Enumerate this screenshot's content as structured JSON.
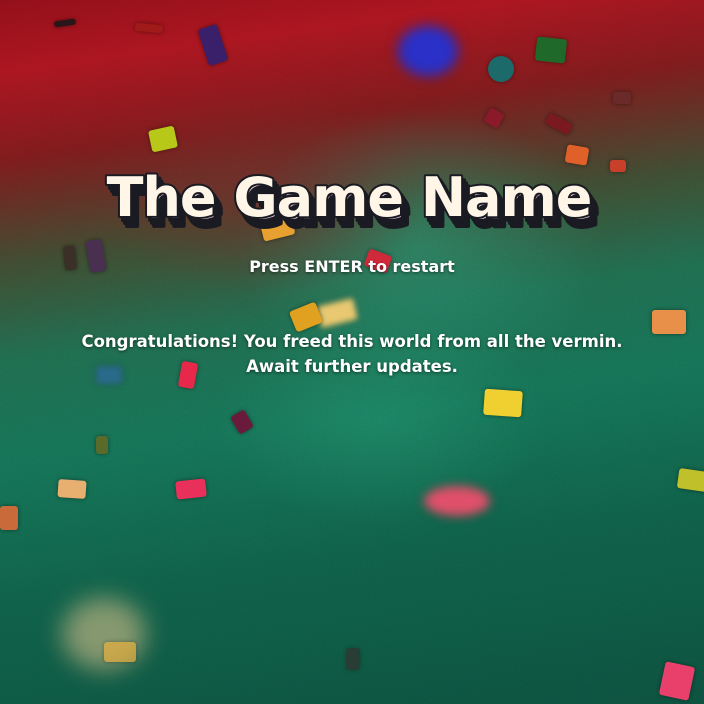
{
  "game": {
    "title": "The Game Name",
    "restart_prompt": "Press ENTER to restart",
    "message_line1": "Congratulations! You freed this world from all the vermin.",
    "message_line2": "Await further updates."
  },
  "colors": {
    "title_fill": "#fff6e8",
    "title_outline": "#1a1a22",
    "title_shadow_1": "#b8a6f0",
    "title_shadow_2": "#7fc8e8",
    "text": "#ffffff"
  }
}
